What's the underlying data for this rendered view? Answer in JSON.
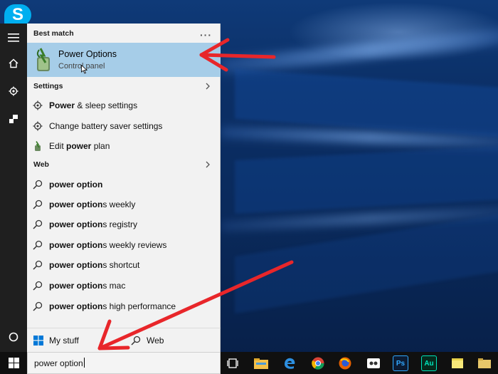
{
  "skype": {
    "glyph": "S"
  },
  "panel": {
    "best_match_header": "Best match",
    "more_glyph": "···",
    "best_match": {
      "title": "Power Options",
      "subtitle": "Control panel"
    },
    "settings_header": "Settings",
    "settings_items": [
      {
        "bold": "Power",
        "rest": " & sleep settings"
      },
      {
        "bold": "",
        "rest": "Change battery saver settings"
      },
      {
        "pre": "Edit ",
        "bold": "power",
        "rest": " plan"
      }
    ],
    "web_header": "Web",
    "web_items": [
      {
        "bold": "power option",
        "rest": ""
      },
      {
        "bold": "power option",
        "rest": "s weekly"
      },
      {
        "bold": "power option",
        "rest": "s registry"
      },
      {
        "bold": "power option",
        "rest": "s weekly reviews"
      },
      {
        "bold": "power option",
        "rest": "s shortcut"
      },
      {
        "bold": "power option",
        "rest": "s mac"
      },
      {
        "bold": "power option",
        "rest": "s high performance"
      }
    ],
    "tabs": {
      "my_stuff": "My stuff",
      "web": "Web"
    }
  },
  "search": {
    "value": "power option"
  },
  "taskbar": {
    "apps": [
      "task-view-icon",
      "file-explorer-icon",
      "edge-icon",
      "chrome-icon",
      "firefox-icon",
      "media-player-icon",
      "photoshop-icon",
      "audition-icon",
      "sticky-notes-icon",
      "folder-icon"
    ],
    "ps_label": "Ps",
    "au_label": "Au"
  },
  "colors": {
    "highlight": "#a6cde8",
    "panel_bg": "#f2f2f2",
    "rail": "#1f1f1f",
    "taskbar": "#101010",
    "arrow": "#e8262a"
  }
}
